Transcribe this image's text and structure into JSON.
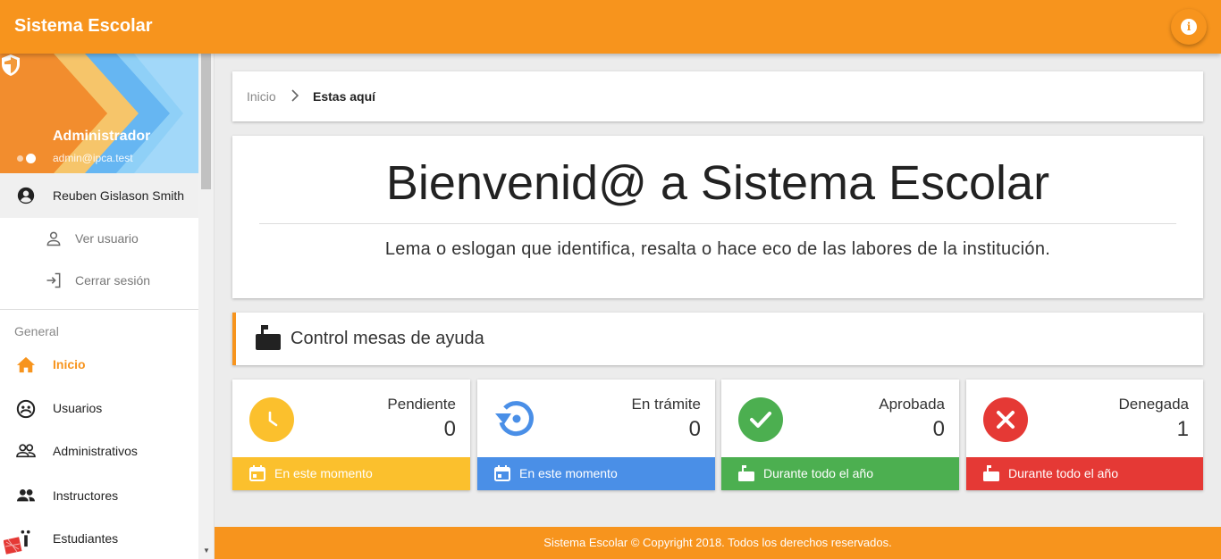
{
  "app": {
    "title": "Sistema Escolar"
  },
  "topbar": {
    "info_icon": "info-icon"
  },
  "profile": {
    "role": "Administrador",
    "email": "admin@ipca.test",
    "user_name": "Reuben Gislason Smith"
  },
  "user_menu": [
    {
      "label": "Ver usuario",
      "icon": "person-outline-icon"
    },
    {
      "label": "Cerrar sesión",
      "icon": "logout-icon"
    }
  ],
  "nav": {
    "section_label": "General",
    "items": [
      {
        "label": "Inicio",
        "icon": "home-icon",
        "active": true
      },
      {
        "label": "Usuarios",
        "icon": "users-circle-icon"
      },
      {
        "label": "Administrativos",
        "icon": "people-outline-icon"
      },
      {
        "label": "Instructores",
        "icon": "people-icon"
      },
      {
        "label": "Estudiantes",
        "icon": "student-icon"
      }
    ]
  },
  "breadcrumb": {
    "home": "Inicio",
    "current": "Estas aquí"
  },
  "welcome": {
    "title": "Bienvenid@ a Sistema Escolar",
    "subtitle": "Lema o eslogan que identifica, resalta o hace eco de las labores de la institución."
  },
  "section": {
    "title": "Control mesas de ayuda",
    "icon": "mailbox-icon"
  },
  "stats": [
    {
      "label": "Pendiente",
      "value": "0",
      "footer": "En este momento",
      "color": "#fbc02d",
      "icon": "clock-icon",
      "footer_icon": "calendar-icon"
    },
    {
      "label": "En trámite",
      "value": "0",
      "footer": "En este momento",
      "color": "#4a8fe7",
      "icon": "restore-icon",
      "footer_icon": "calendar-icon"
    },
    {
      "label": "Aprobada",
      "value": "0",
      "footer": "Durante todo el año",
      "color": "#4caf50",
      "icon": "check-icon",
      "footer_icon": "mailbox-icon"
    },
    {
      "label": "Denegada",
      "value": "1",
      "footer": "Durante todo el año",
      "color": "#e53935",
      "icon": "close-icon",
      "footer_icon": "mailbox-icon"
    }
  ],
  "footer": {
    "text": "Sistema Escolar © Copyright 2018. Todos los derechos reservados."
  }
}
